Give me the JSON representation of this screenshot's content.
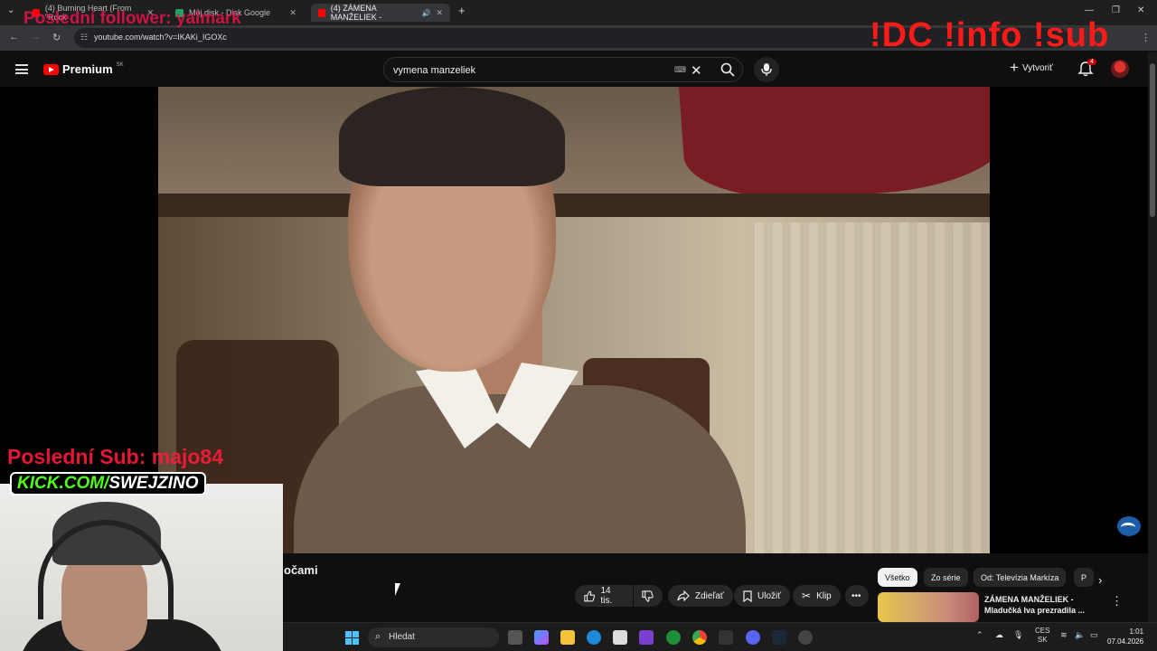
{
  "browser": {
    "tabs": [
      {
        "label": "(4) Burning Heart (From \"Rock"
      },
      {
        "label": "Môj disk - Disk Google"
      },
      {
        "label": "(4) ZÁMENA MANŽELIEK -"
      }
    ],
    "url": "youtube.com/watch?v=IKAKi_IGOXc"
  },
  "overlays": {
    "follower": "Poslední follower: yalmark",
    "commands": "!DC !info !sub",
    "last_sub": "Poslední Sub: majo84",
    "kick_prefix": "KICK.COM/",
    "kick_name": "SWEJZINO"
  },
  "youtube": {
    "logo_text": "Premium",
    "region": "SK",
    "search_query": "vymena manzeliek",
    "create_label": "Vytvoriť",
    "notif_count": "4"
  },
  "video": {
    "title_fragment": "očami"
  },
  "actions": {
    "likes": "14 tis.",
    "share": "Zdieľať",
    "save": "Uložiť",
    "clip": "Klip"
  },
  "chips": [
    "Všetko",
    "Zo série",
    "Od: Televízia Markíza",
    "P"
  ],
  "recommendation": {
    "title": "ZÁMENA MANŽELIEK - Mladučká Iva prezradila ..."
  },
  "taskbar": {
    "search_label": "Hledat",
    "lang_top": "CES",
    "lang_bottom": "SK",
    "time": "1:01",
    "date": "07.04.2026"
  },
  "colors": {
    "accent_red": "#ff0000",
    "overlay_red": "#ff1a1a",
    "kick_green": "#53fc18"
  }
}
